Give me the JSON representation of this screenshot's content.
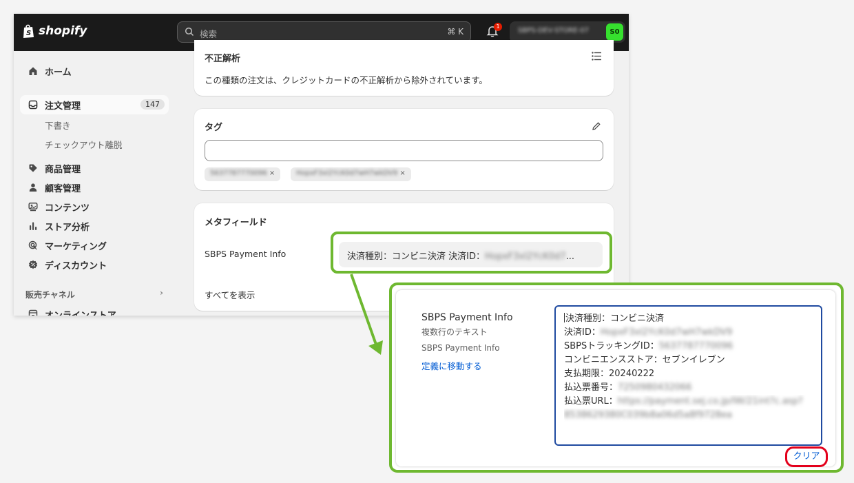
{
  "topbar": {
    "logo_text": "shopify",
    "search_placeholder": "検索",
    "search_shortcut": "⌘ K",
    "notification_count": "1",
    "store_name": "SBPS-DEV-STORE-07",
    "avatar_initials": "S0"
  },
  "sidebar": {
    "items": [
      {
        "label": "ホーム",
        "icon": "home-icon"
      },
      {
        "label": "注文管理",
        "icon": "orders-icon",
        "count": "147"
      },
      {
        "label": "商品管理",
        "icon": "tag-icon"
      },
      {
        "label": "顧客管理",
        "icon": "person-icon"
      },
      {
        "label": "コンテンツ",
        "icon": "content-icon"
      },
      {
        "label": "ストア分析",
        "icon": "analytics-icon"
      },
      {
        "label": "マーケティング",
        "icon": "marketing-icon"
      },
      {
        "label": "ディスカウント",
        "icon": "discount-icon"
      }
    ],
    "sub_items": [
      "下書き",
      "チェックアウト離脱"
    ],
    "section_label": "販売チャネル",
    "online_store": "オンラインストア"
  },
  "fraud_card": {
    "title": "不正解析",
    "text": "この種類の注文は、クレジットカードの不正解析から除外されています。"
  },
  "tags_card": {
    "title": "タグ",
    "tags": [
      "5637787770096",
      "HopxF3xI2YcK0d7wH7wkDV9"
    ]
  },
  "metafields_card": {
    "title": "メタフィールド",
    "field_label": "SBPS Payment Info",
    "value_prefix": "決済種別：コンビニ決済 決済ID：",
    "value_blurred": "HopxF3xI2YcK0d7",
    "value_suffix": "...",
    "show_all": "すべてを表示"
  },
  "popup": {
    "title": "SBPS Payment Info",
    "type_label": "複数行のテキスト",
    "namespace": "SBPS Payment Info",
    "definition_link": "定義に移動する",
    "lines": [
      {
        "label": "決済種別：",
        "value": "コンビニ決済"
      },
      {
        "label": "決済ID：",
        "blurred": "HopxF3xI2YcK0d7wH7wkDV9"
      },
      {
        "label": "SBPSトラッキングID：",
        "blurred": "5637787770096"
      },
      {
        "label": "コンビニエンスストア：",
        "value": "セブンイレブン"
      },
      {
        "label": "支払期限：",
        "value": "20240222"
      },
      {
        "label": "払込票番号：",
        "blurred": "7250980432066"
      },
      {
        "label": "払込票URL：",
        "blurred": "https://payment.sej.co.jp/IW/21int?c.asp?"
      },
      {
        "label": "",
        "blurred": "8538629380C039b8a06d5a8f9728ea"
      }
    ],
    "clear_label": "クリア"
  }
}
